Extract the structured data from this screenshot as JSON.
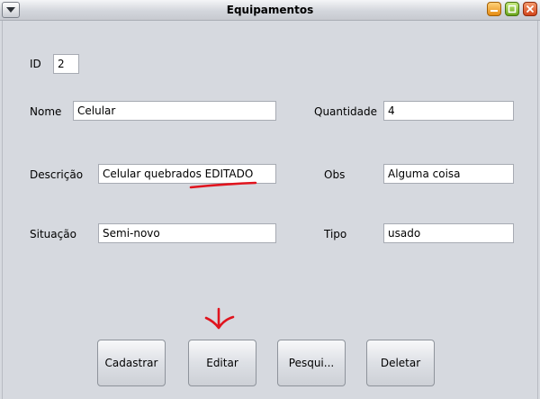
{
  "window": {
    "title": "Equipamentos"
  },
  "form": {
    "id_label": "ID",
    "id_value": "2",
    "nome_label": "Nome",
    "nome_value": "Celular",
    "quantidade_label": "Quantidade",
    "quantidade_value": "4",
    "descricao_label": "Descrição",
    "descricao_value": "Celular quebrados EDITADO",
    "obs_label": "Obs",
    "obs_value": "Alguma coisa",
    "situacao_label": "Situação",
    "situacao_value": "Semi-novo",
    "tipo_label": "Tipo",
    "tipo_value": "usado"
  },
  "buttons": {
    "cadastrar": "Cadastrar",
    "editar": "Editar",
    "pesquisar": "Pesqui...",
    "deletar": "Deletar"
  },
  "annotation_color": "#e0141e"
}
